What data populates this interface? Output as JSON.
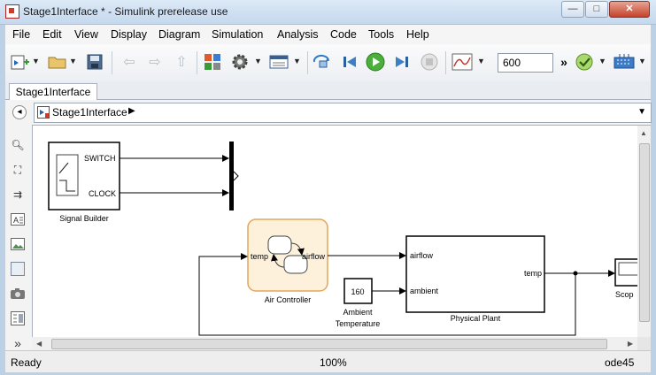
{
  "window": {
    "title": "Stage1Interface * - Simulink prerelease use",
    "minimize_label": "—",
    "maximize_label": "□",
    "close_label": "✕"
  },
  "menu": [
    "File",
    "Edit",
    "View",
    "Display",
    "Diagram",
    "Simulation",
    "Analysis",
    "Code",
    "Tools",
    "Help"
  ],
  "toolbar": {
    "stop_time": "600",
    "more_label": "»"
  },
  "tab": {
    "label": "Stage1Interface"
  },
  "address": {
    "label": "Stage1Interface"
  },
  "diagram": {
    "signal_builder": {
      "name": "Signal Builder",
      "port_switch": "SWITCH",
      "port_clock": "CLOCK"
    },
    "air_controller": {
      "name": "Air Controller",
      "in_port": "temp",
      "out_port": "airflow"
    },
    "constant": {
      "value": "160",
      "name_line1": "Ambient",
      "name_line2": "Temperature"
    },
    "plant": {
      "name": "Physical Plant",
      "in_port1": "airflow",
      "in_port2": "ambient",
      "out_port": "temp"
    },
    "scope": {
      "name": "Scop"
    }
  },
  "status": {
    "state": "Ready",
    "zoom": "100%",
    "solver": "ode45"
  },
  "colors": {
    "chart_fill": "#fdf1dc",
    "chart_border": "#e2a75a",
    "canvas_bg": "#ffffff"
  }
}
